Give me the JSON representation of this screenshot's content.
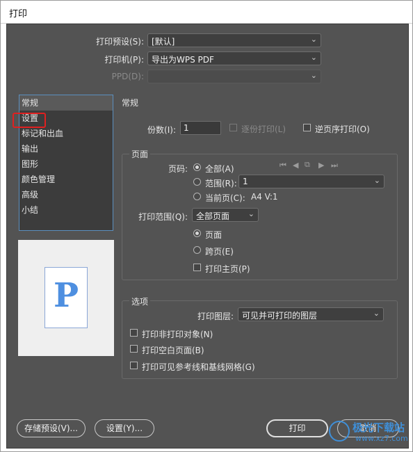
{
  "window": {
    "title": "打印"
  },
  "top": {
    "preset_label": "打印预设(S):",
    "preset_value": "[默认]",
    "printer_label": "打印机(P):",
    "printer_value": "导出为WPS PDF",
    "ppd_label": "PPD(D):",
    "ppd_value": ""
  },
  "sidebar": {
    "items": [
      {
        "label": "常规"
      },
      {
        "label": "设置"
      },
      {
        "label": "标记和出血"
      },
      {
        "label": "输出"
      },
      {
        "label": "图形"
      },
      {
        "label": "颜色管理"
      },
      {
        "label": "高级"
      },
      {
        "label": "小结"
      }
    ],
    "selected": "常规",
    "highlighted": "设置"
  },
  "preview": {
    "glyph": "P"
  },
  "general": {
    "heading": "常规",
    "copies_label": "份数(I):",
    "copies_value": "1",
    "collate_label": "逐份打印(L)",
    "reverse_label": "逆页序打印(O)"
  },
  "pages": {
    "title": "页面",
    "pages_label": "页码:",
    "all_label": "全部(A)",
    "range_label": "范围(R):",
    "range_value": "1",
    "current_label": "当前页(C):",
    "current_value": "A4 V:1",
    "print_range_label": "打印范围(Q):",
    "print_range_value": "全部页面",
    "page_label": "页面",
    "spread_label": "跨页(E)",
    "master_label": "打印主页(P)"
  },
  "options": {
    "title": "选项",
    "layers_label": "打印图层:",
    "layers_value": "可见并可打印的图层",
    "nonprint_label": "打印非打印对象(N)",
    "blank_label": "打印空白页面(B)",
    "guides_label": "打印可见参考线和基线网格(G)"
  },
  "footer": {
    "save_preset": "存储预设(V)...",
    "setup": "设置(Y)...",
    "print": "打印",
    "cancel": "取消"
  },
  "watermark": {
    "text": "极光下载站",
    "url": "www.xz7.com"
  }
}
